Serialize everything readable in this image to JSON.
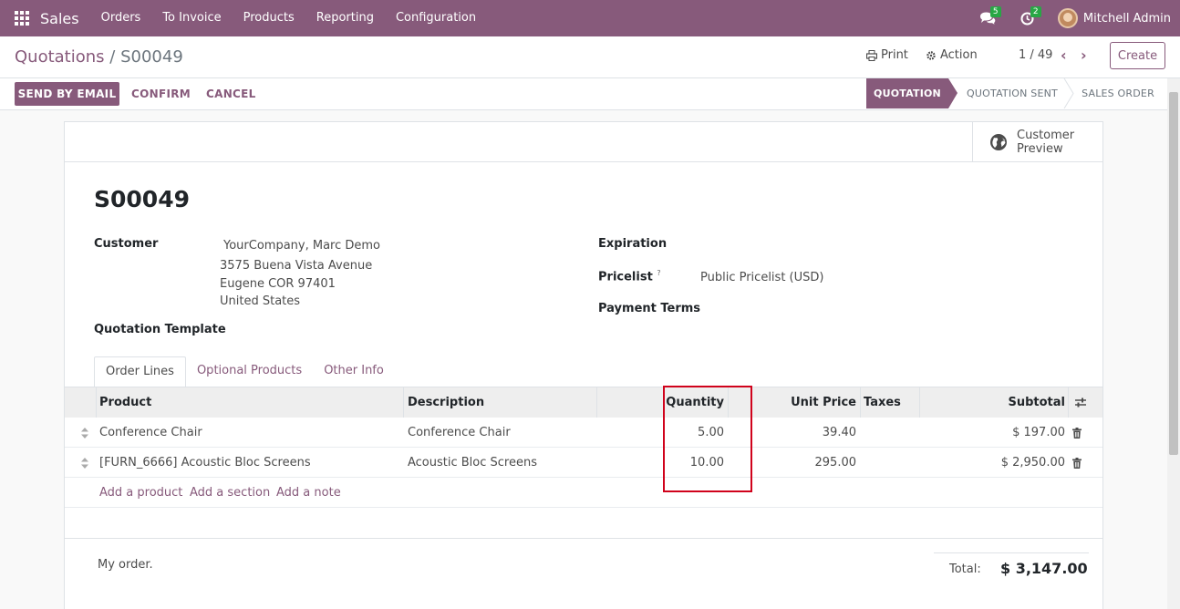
{
  "navbar": {
    "app_name": "Sales",
    "menu": [
      "Orders",
      "To Invoice",
      "Products",
      "Reporting",
      "Configuration"
    ],
    "messages_count": "5",
    "activities_count": "2",
    "user_name": "Mitchell Admin"
  },
  "control_panel": {
    "breadcrumb_parent": "Quotations",
    "breadcrumb_sep": "/",
    "breadcrumb_current": "S00049",
    "print_label": "Print",
    "action_label": "Action",
    "pager": "1 / 49",
    "create_label": "Create"
  },
  "statusbar": {
    "send_email": "SEND BY EMAIL",
    "confirm": "CONFIRM",
    "cancel": "CANCEL",
    "stages": [
      "QUOTATION",
      "QUOTATION SENT",
      "SALES ORDER"
    ]
  },
  "sheet": {
    "preview_label_1": "Customer",
    "preview_label_2": "Preview",
    "title": "S00049",
    "customer_label": "Customer",
    "customer_lines": [
      "YourCompany, Marc Demo",
      "3575 Buena Vista Avenue",
      "Eugene COR 97401",
      "United States"
    ],
    "quotation_template_label": "Quotation Template",
    "expiration_label": "Expiration",
    "pricelist_label": "Pricelist",
    "pricelist_help": "?",
    "pricelist_value": "Public Pricelist (USD)",
    "payment_terms_label": "Payment Terms",
    "tabs": [
      "Order Lines",
      "Optional Products",
      "Other Info"
    ]
  },
  "order_lines": {
    "headers": {
      "product": "Product",
      "description": "Description",
      "quantity": "Quantity",
      "unit_price": "Unit Price",
      "taxes": "Taxes",
      "subtotal": "Subtotal"
    },
    "rows": [
      {
        "product": "Conference Chair",
        "description": "Conference Chair",
        "quantity": "5.00",
        "unit_price": "39.40",
        "taxes": "",
        "subtotal": "$ 197.00"
      },
      {
        "product": "[FURN_6666] Acoustic Bloc Screens",
        "description": "Acoustic Bloc Screens",
        "quantity": "10.00",
        "unit_price": "295.00",
        "taxes": "",
        "subtotal": "$ 2,950.00"
      }
    ],
    "add_product": "Add a product",
    "add_section": "Add a section",
    "add_note": "Add a note"
  },
  "footer": {
    "note": "My order.",
    "total_label": "Total:",
    "total_value": "$ 3,147.00"
  },
  "colors": {
    "brand": "#875a7b",
    "highlight": "#d0021b",
    "badge": "#28a745"
  }
}
